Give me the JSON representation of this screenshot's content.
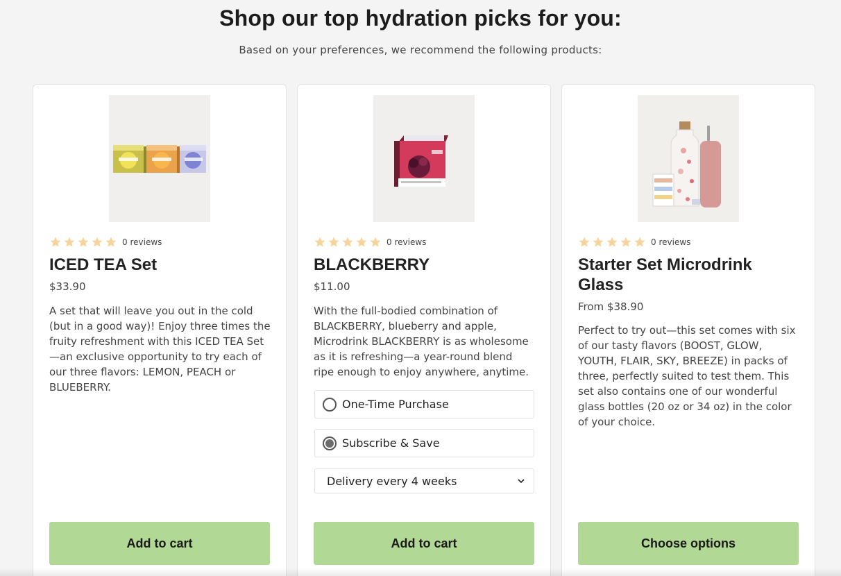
{
  "header": {
    "title": "Shop our top hydration picks for you:",
    "subtitle": "Based on your preferences, we recommend the following products:"
  },
  "colors": {
    "button_bg": "#b1d995",
    "star_color": "#f7d49c",
    "card_border": "#e3e3e3"
  },
  "products": [
    {
      "image_name": "iced-tea-set-product-image",
      "rating_stars": 5,
      "reviews": "0 reviews",
      "title": "ICED TEA Set",
      "price": "$33.90",
      "description": "A set that will leave you out in the cold (but in a good way)! Enjoy three times the fruity refreshment with this ICED TEA Set—an exclusive opportunity to try each of our three flavors: LEMON, PEACH or BLUEBERRY.",
      "button_label": "Add to cart"
    },
    {
      "image_name": "blackberry-product-image",
      "rating_stars": 5,
      "reviews": "0 reviews",
      "title": "BLACKBERRY",
      "price": "$11.00",
      "description": "With the full-bodied combination of BLACKBERRY, blueberry and apple, Microdrink BLACKBERRY is as wholesome as it is refreshing—a year-round blend ripe enough to enjoy anywhere, anytime.",
      "purchase_options": [
        {
          "label": "One-Time Purchase",
          "selected": false
        },
        {
          "label": "Subscribe & Save",
          "selected": true
        }
      ],
      "delivery_select": "Delivery every 4 weeks",
      "button_label": "Add to cart"
    },
    {
      "image_name": "starter-set-glass-product-image",
      "rating_stars": 5,
      "reviews": "0 reviews",
      "title": "Starter Set Microdrink Glass",
      "price": "From $38.90",
      "description": "Perfect to try out—this set comes with six of our tasty flavors (BOOST, GLOW, YOUTH, FLAIR, SKY, BREEZE) in packs of three, perfectly suited to test them. This set also contains one of our wonderful glass bottles (20 oz or 34 oz) in the color of your choice.",
      "button_label": "Choose options"
    }
  ]
}
